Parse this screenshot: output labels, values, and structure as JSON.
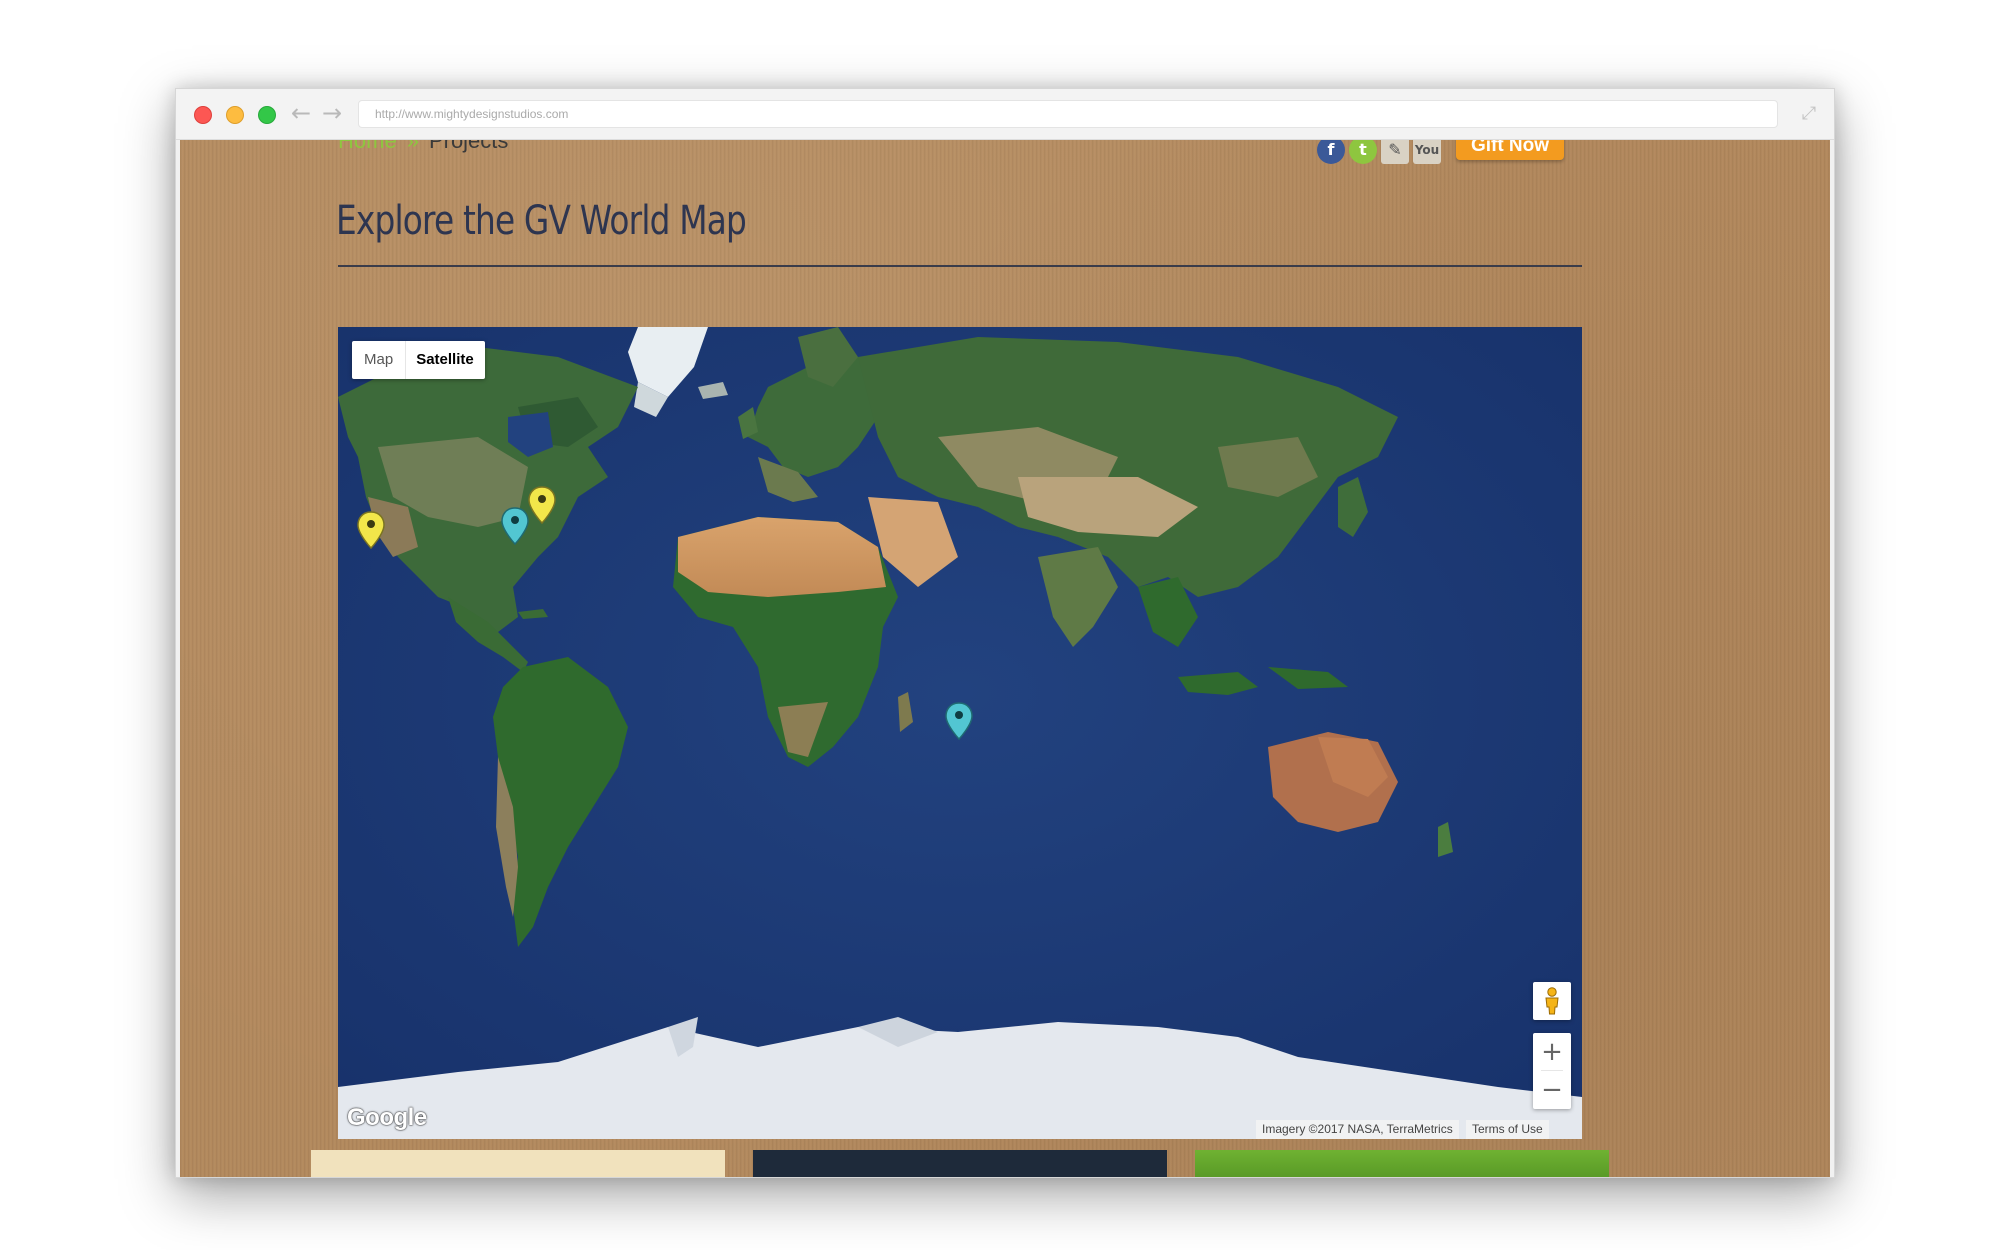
{
  "browser": {
    "url": "http://www.mightydesignstudios.com",
    "back_icon": "arrow-left-icon",
    "forward_icon": "arrow-right-icon",
    "expand_icon": "expand-icon"
  },
  "nav": {
    "breadcrumb": {
      "home": "Home",
      "separator": "»",
      "current": "Projects"
    },
    "social": {
      "facebook": "f",
      "twitter": "t",
      "blog": "✎",
      "youtube": "You"
    },
    "gift_label": "Gift Now"
  },
  "page": {
    "title": "Explore the GV World Map"
  },
  "map": {
    "type_control": {
      "map_label": "Map",
      "satellite_label": "Satellite",
      "selected": "Satellite"
    },
    "zoom_in_label": "+",
    "zoom_out_label": "−",
    "logo": "Google",
    "imagery_credit": "Imagery ©2017 NASA, TerraMetrics",
    "terms": "Terms of Use",
    "colors": {
      "ocean": "#1f3c78",
      "pin_yellow": "#f2e64a",
      "pin_cyan": "#52c6d2"
    }
  }
}
